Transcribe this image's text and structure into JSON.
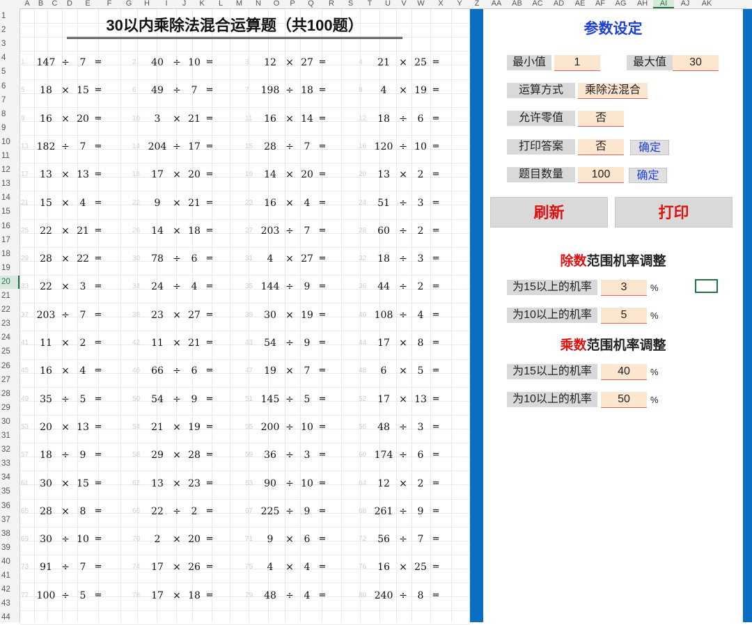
{
  "column_headers": [
    "A",
    "B",
    "C",
    "D",
    "E",
    "F",
    "G",
    "H",
    "I",
    "J",
    "K",
    "L",
    "M",
    "N",
    "O",
    "P",
    "Q",
    "R",
    "S",
    "T",
    "U",
    "V",
    "W",
    "X",
    "Y",
    "Z",
    "AA",
    "AB",
    "AC",
    "AD",
    "AE",
    "AF",
    "AG",
    "AH",
    "AI",
    "AJ",
    "AK"
  ],
  "row_headers": [
    "1",
    "2",
    "3",
    "4",
    "5",
    "6",
    "7",
    "8",
    "9",
    "10",
    "11",
    "12",
    "13",
    "14",
    "15",
    "16",
    "17",
    "18",
    "19",
    "20",
    "21",
    "22",
    "23",
    "24",
    "25",
    "26",
    "27",
    "28",
    "29",
    "30",
    "31",
    "32",
    "33",
    "34",
    "35",
    "36",
    "37",
    "38",
    "39",
    "40",
    "41",
    "42",
    "43",
    "44"
  ],
  "selected_column": "AI",
  "selected_row": "20",
  "sheet_title": "30以内乘除法混合运算题（共100题）",
  "questions": [
    [
      "1",
      "147",
      "÷",
      "7",
      "="
    ],
    [
      "2",
      "40",
      "÷",
      "10",
      "="
    ],
    [
      "3",
      "12",
      "×",
      "27",
      "="
    ],
    [
      "4",
      "21",
      "×",
      "25",
      "="
    ],
    [
      "5",
      "18",
      "×",
      "15",
      "="
    ],
    [
      "6",
      "49",
      "÷",
      "7",
      "="
    ],
    [
      "7",
      "198",
      "÷",
      "18",
      "="
    ],
    [
      "8",
      "4",
      "×",
      "19",
      "="
    ],
    [
      "9",
      "16",
      "×",
      "20",
      "="
    ],
    [
      "10",
      "3",
      "×",
      "21",
      "="
    ],
    [
      "11",
      "16",
      "×",
      "14",
      "="
    ],
    [
      "12",
      "18",
      "÷",
      "6",
      "="
    ],
    [
      "13",
      "182",
      "÷",
      "7",
      "="
    ],
    [
      "14",
      "204",
      "÷",
      "17",
      "="
    ],
    [
      "15",
      "28",
      "÷",
      "7",
      "="
    ],
    [
      "16",
      "120",
      "÷",
      "10",
      "="
    ],
    [
      "17",
      "13",
      "×",
      "13",
      "="
    ],
    [
      "18",
      "17",
      "×",
      "20",
      "="
    ],
    [
      "19",
      "14",
      "×",
      "20",
      "="
    ],
    [
      "20",
      "13",
      "×",
      "2",
      "="
    ],
    [
      "21",
      "15",
      "×",
      "4",
      "="
    ],
    [
      "22",
      "9",
      "×",
      "21",
      "="
    ],
    [
      "23",
      "16",
      "×",
      "4",
      "="
    ],
    [
      "24",
      "51",
      "÷",
      "3",
      "="
    ],
    [
      "25",
      "22",
      "×",
      "21",
      "="
    ],
    [
      "26",
      "14",
      "×",
      "18",
      "="
    ],
    [
      "27",
      "203",
      "÷",
      "7",
      "="
    ],
    [
      "28",
      "60",
      "÷",
      "2",
      "="
    ],
    [
      "29",
      "28",
      "×",
      "22",
      "="
    ],
    [
      "30",
      "78",
      "÷",
      "6",
      "="
    ],
    [
      "31",
      "4",
      "×",
      "27",
      "="
    ],
    [
      "32",
      "18",
      "÷",
      "3",
      "="
    ],
    [
      "33",
      "22",
      "×",
      "3",
      "="
    ],
    [
      "34",
      "24",
      "÷",
      "4",
      "="
    ],
    [
      "35",
      "144",
      "÷",
      "9",
      "="
    ],
    [
      "36",
      "44",
      "÷",
      "2",
      "="
    ],
    [
      "37",
      "203",
      "÷",
      "7",
      "="
    ],
    [
      "38",
      "23",
      "×",
      "27",
      "="
    ],
    [
      "39",
      "30",
      "×",
      "19",
      "="
    ],
    [
      "40",
      "108",
      "÷",
      "4",
      "="
    ],
    [
      "41",
      "11",
      "×",
      "2",
      "="
    ],
    [
      "42",
      "11",
      "×",
      "21",
      "="
    ],
    [
      "43",
      "54",
      "÷",
      "9",
      "="
    ],
    [
      "44",
      "17",
      "×",
      "8",
      "="
    ],
    [
      "45",
      "16",
      "×",
      "4",
      "="
    ],
    [
      "46",
      "66",
      "÷",
      "6",
      "="
    ],
    [
      "47",
      "19",
      "×",
      "7",
      "="
    ],
    [
      "48",
      "6",
      "×",
      "5",
      "="
    ],
    [
      "49",
      "35",
      "÷",
      "5",
      "="
    ],
    [
      "50",
      "54",
      "÷",
      "9",
      "="
    ],
    [
      "51",
      "145",
      "÷",
      "5",
      "="
    ],
    [
      "52",
      "17",
      "×",
      "13",
      "="
    ],
    [
      "53",
      "20",
      "×",
      "13",
      "="
    ],
    [
      "54",
      "21",
      "×",
      "19",
      "="
    ],
    [
      "55",
      "200",
      "÷",
      "10",
      "="
    ],
    [
      "56",
      "48",
      "÷",
      "3",
      "="
    ],
    [
      "57",
      "18",
      "÷",
      "9",
      "="
    ],
    [
      "58",
      "29",
      "×",
      "28",
      "="
    ],
    [
      "59",
      "36",
      "÷",
      "3",
      "="
    ],
    [
      "60",
      "174",
      "÷",
      "6",
      "="
    ],
    [
      "61",
      "30",
      "×",
      "15",
      "="
    ],
    [
      "62",
      "13",
      "×",
      "23",
      "="
    ],
    [
      "63",
      "90",
      "÷",
      "10",
      "="
    ],
    [
      "64",
      "12",
      "×",
      "2",
      "="
    ],
    [
      "65",
      "28",
      "×",
      "8",
      "="
    ],
    [
      "66",
      "22",
      "÷",
      "2",
      "="
    ],
    [
      "67",
      "225",
      "÷",
      "9",
      "="
    ],
    [
      "68",
      "261",
      "÷",
      "9",
      "="
    ],
    [
      "69",
      "30",
      "÷",
      "10",
      "="
    ],
    [
      "70",
      "2",
      "×",
      "20",
      "="
    ],
    [
      "71",
      "9",
      "×",
      "6",
      "="
    ],
    [
      "72",
      "56",
      "÷",
      "7",
      "="
    ],
    [
      "73",
      "91",
      "÷",
      "7",
      "="
    ],
    [
      "74",
      "17",
      "×",
      "26",
      "="
    ],
    [
      "75",
      "4",
      "×",
      "4",
      "="
    ],
    [
      "76",
      "16",
      "×",
      "25",
      "="
    ],
    [
      "77",
      "100",
      "÷",
      "5",
      "="
    ],
    [
      "78",
      "17",
      "×",
      "18",
      "="
    ],
    [
      "79",
      "48",
      "÷",
      "4",
      "="
    ],
    [
      "80",
      "240",
      "÷",
      "8",
      "="
    ]
  ],
  "panel": {
    "title": "参数设定",
    "min_label": "最小值",
    "min_value": "1",
    "max_label": "最大值",
    "max_value": "30",
    "op_label": "运算方式",
    "op_value": "乘除法混合",
    "zero_label": "允许零值",
    "zero_value": "否",
    "print_answer_label": "打印答案",
    "print_answer_value": "否",
    "print_answer_ok": "确定",
    "count_label": "题目数量",
    "count_value": "100",
    "count_ok": "确定",
    "refresh_button": "刷新",
    "print_button": "打印",
    "div_section_red": "除数",
    "div_section_rest": "范围机率调整",
    "div15_label": "为15以上的机率",
    "div15_value": "3",
    "div10_label": "为10以上的机率",
    "div10_value": "5",
    "mul_section_red": "乘数",
    "mul_section_rest": "范围机率调整",
    "mul15_label": "为15以上的机率",
    "mul15_value": "40",
    "mul10_label": "为10以上的机率",
    "mul10_value": "50",
    "percent": "%"
  },
  "colors": {
    "panel_border": "#0a6ec2",
    "accent_red": "#e01010",
    "title_blue": "#1f3fd6",
    "input_bg": "#fde6cf"
  }
}
